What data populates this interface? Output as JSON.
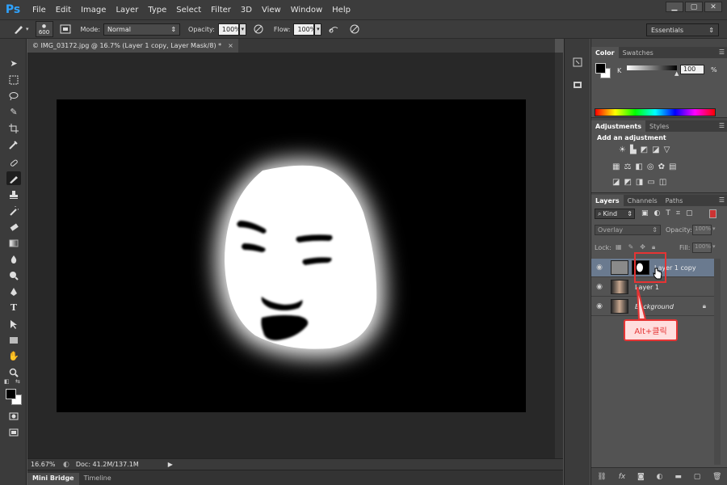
{
  "menubar": {
    "logo": "Ps",
    "items": [
      "File",
      "Edit",
      "Image",
      "Layer",
      "Type",
      "Select",
      "Filter",
      "3D",
      "View",
      "Window",
      "Help"
    ],
    "window_controls": [
      "▁",
      "▢",
      "✕"
    ]
  },
  "options": {
    "brush_size": "600",
    "mode_label": "Mode:",
    "mode_value": "Normal",
    "opacity_label": "Opacity:",
    "opacity_value": "100%",
    "flow_label": "Flow:",
    "flow_value": "100%",
    "workspace": "Essentials"
  },
  "document": {
    "tab_title": "© IMG_03172.jpg @ 16.7% (Layer 1 copy, Layer Mask/8) *",
    "tab_close": "×",
    "zoom": "16.67%",
    "doc_info": "Doc: 41.2M/137.1M"
  },
  "bottom_tabs": [
    "Mini Bridge",
    "Timeline"
  ],
  "color_panel": {
    "tabs": [
      "Color",
      "Swatches"
    ],
    "channel_label": "K",
    "value": "100",
    "unit": "%"
  },
  "adjustments_panel": {
    "tabs": [
      "Adjustments",
      "Styles"
    ],
    "heading": "Add an adjustment"
  },
  "layers_panel": {
    "tabs": [
      "Layers",
      "Channels",
      "Paths"
    ],
    "filter_label": "Kind",
    "blend_mode": "Overlay",
    "opacity_label": "Opacity:",
    "opacity_value": "100%",
    "lock_label": "Lock:",
    "fill_label": "Fill:",
    "fill_value": "100%",
    "layers": [
      {
        "name": "Layer 1 copy",
        "selected": true
      },
      {
        "name": "Layer 1",
        "selected": false
      },
      {
        "name": "Background",
        "selected": false
      }
    ]
  },
  "annotation": {
    "callout_text": "Alt+클릭"
  },
  "colors": {
    "accent_red": "#e53434",
    "selected_layer": "#6a7a8f"
  }
}
